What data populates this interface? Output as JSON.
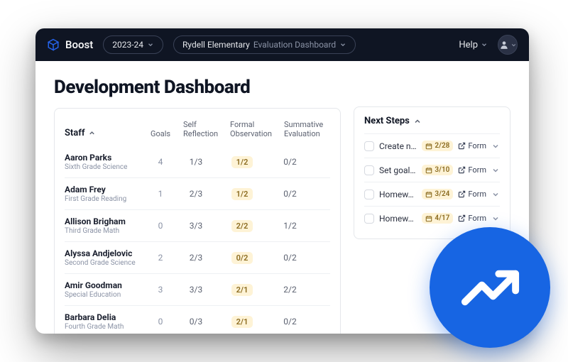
{
  "brand": "Boost",
  "year": "2023-24",
  "school": "Rydell Elementary",
  "context": "Evaluation Dashboard",
  "help": "Help",
  "page_title": "Development Dashboard",
  "cols": {
    "staff": "Staff",
    "goals": "Goals",
    "self": "Self Reflection",
    "formal": "Formal Observation",
    "sum": "Summative Evaluation"
  },
  "rows": [
    {
      "name": "Aaron Parks",
      "sub": "Sixth Grade Science",
      "goals": "4",
      "self": "1/3",
      "formal": "1/2",
      "sum": "0/2"
    },
    {
      "name": "Adam Frey",
      "sub": "First Grade Reading",
      "goals": "1",
      "self": "2/3",
      "formal": "1/2",
      "sum": "0/2"
    },
    {
      "name": "Allison Brigham",
      "sub": "Third Grade Math",
      "goals": "0",
      "self": "3/3",
      "formal": "2/2",
      "sum": "1/2"
    },
    {
      "name": "Alyssa Andjelovic",
      "sub": "Second Grade Science",
      "goals": "2",
      "self": "2/3",
      "formal": "0/2",
      "sum": "0/2"
    },
    {
      "name": "Amir Goodman",
      "sub": "Special Education",
      "goals": "3",
      "self": "3/3",
      "formal": "2/1",
      "sum": "2/2"
    },
    {
      "name": "Barbara Delia",
      "sub": "Fourth Grade Math",
      "goals": "0",
      "self": "0/3",
      "formal": "2/1",
      "sum": "0/2"
    }
  ],
  "ns_title": "Next Steps",
  "form_label": "Form",
  "steps": [
    {
      "title": "Create n…",
      "date": "2/28"
    },
    {
      "title": "Set goal…",
      "date": "3/10"
    },
    {
      "title": "Homew…",
      "date": "3/24"
    },
    {
      "title": "Homew…",
      "date": "4/17"
    }
  ]
}
